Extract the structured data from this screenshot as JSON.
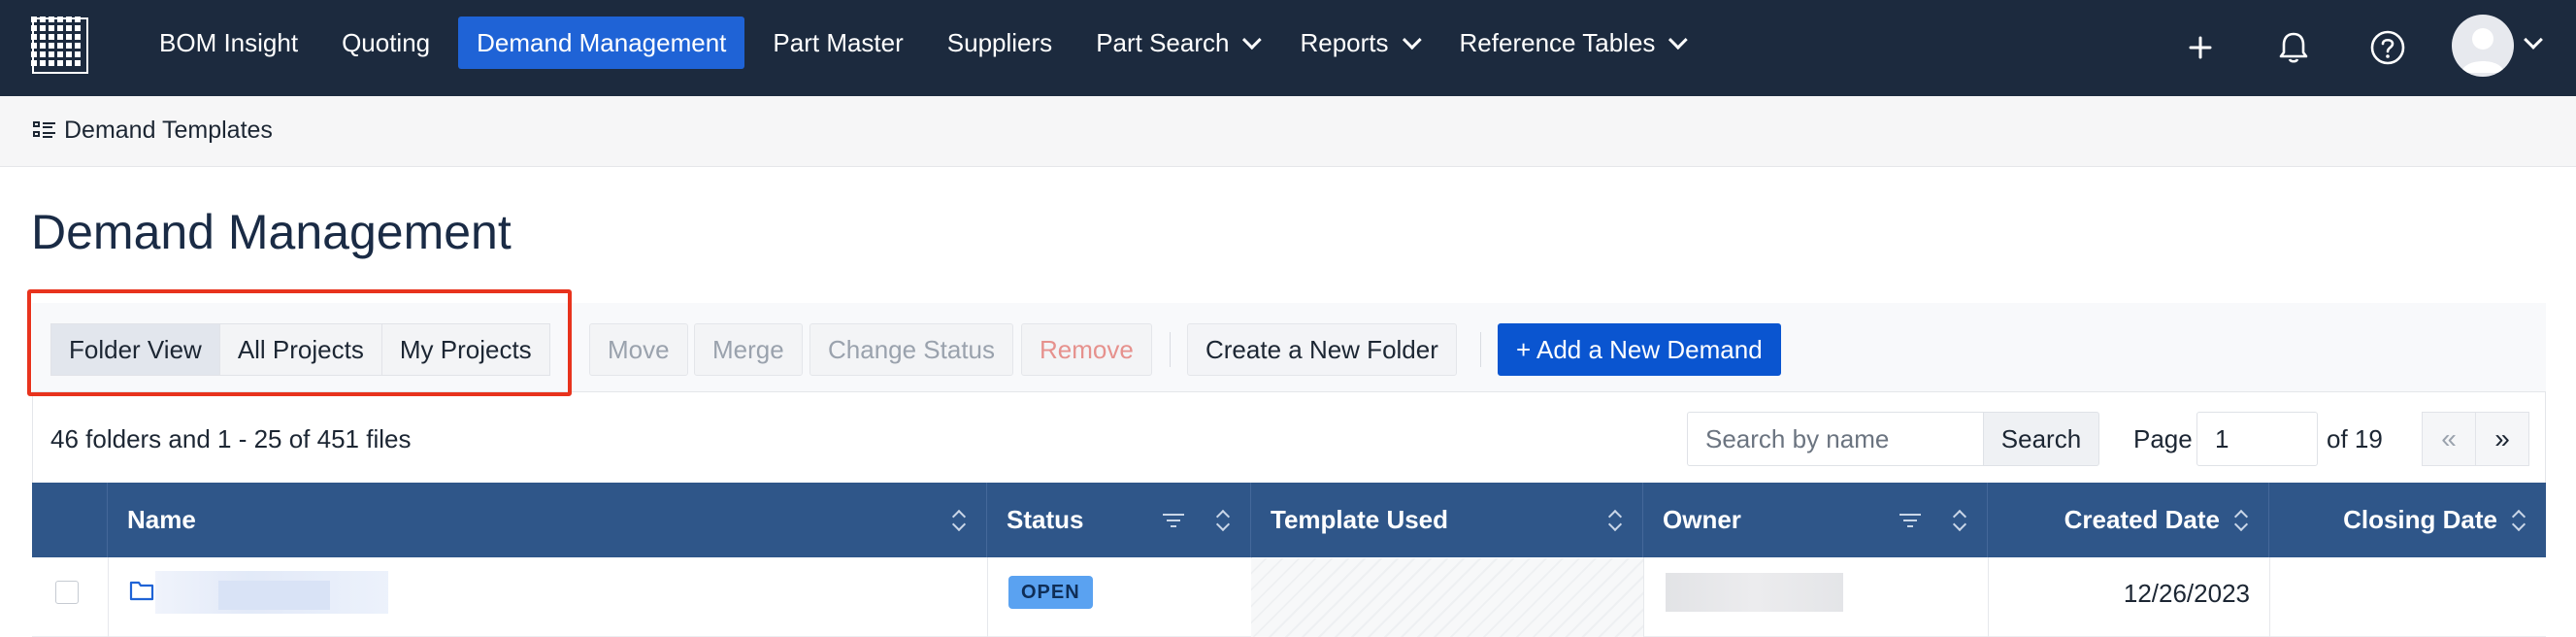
{
  "nav": {
    "items": [
      {
        "label": "BOM Insight",
        "active": false,
        "dropdown": false
      },
      {
        "label": "Quoting",
        "active": false,
        "dropdown": false
      },
      {
        "label": "Demand Management",
        "active": true,
        "dropdown": false
      },
      {
        "label": "Part Master",
        "active": false,
        "dropdown": false
      },
      {
        "label": "Suppliers",
        "active": false,
        "dropdown": false
      },
      {
        "label": "Part Search",
        "active": false,
        "dropdown": true
      },
      {
        "label": "Reports",
        "active": false,
        "dropdown": true
      },
      {
        "label": "Reference Tables",
        "active": false,
        "dropdown": true
      }
    ],
    "icons": [
      "plus-icon",
      "bell-icon",
      "help-icon",
      "avatar"
    ]
  },
  "subheader": {
    "title": "Demand Templates"
  },
  "page": {
    "title": "Demand Management"
  },
  "toolbar": {
    "views": [
      "Folder View",
      "All Projects",
      "My Projects"
    ],
    "active_view": "Folder View",
    "move": "Move",
    "merge": "Merge",
    "change_status": "Change Status",
    "remove": "Remove",
    "create_folder": "Create a New Folder",
    "add_demand": "+ Add a New Demand"
  },
  "listing": {
    "summary": "46 folders and 1 - 25 of 451 files",
    "search_placeholder": "Search by name",
    "search_button": "Search",
    "page_label": "Page",
    "page_value": "1",
    "page_of": "of 19",
    "first": "«",
    "last": "»"
  },
  "table": {
    "columns": [
      "Name",
      "Status",
      "Template Used",
      "Owner",
      "Created Date",
      "Closing Date"
    ],
    "rows": [
      {
        "type": "folder",
        "status": "OPEN",
        "created_date": "12/26/2023",
        "closing_date": ""
      }
    ]
  },
  "colors": {
    "nav_bg": "#1c2a3e",
    "nav_active": "#1f63d6",
    "table_header": "#2f5689",
    "primary_button": "#0a55d0",
    "highlight": "#e8331d",
    "status_open": "#5aa2f1"
  }
}
